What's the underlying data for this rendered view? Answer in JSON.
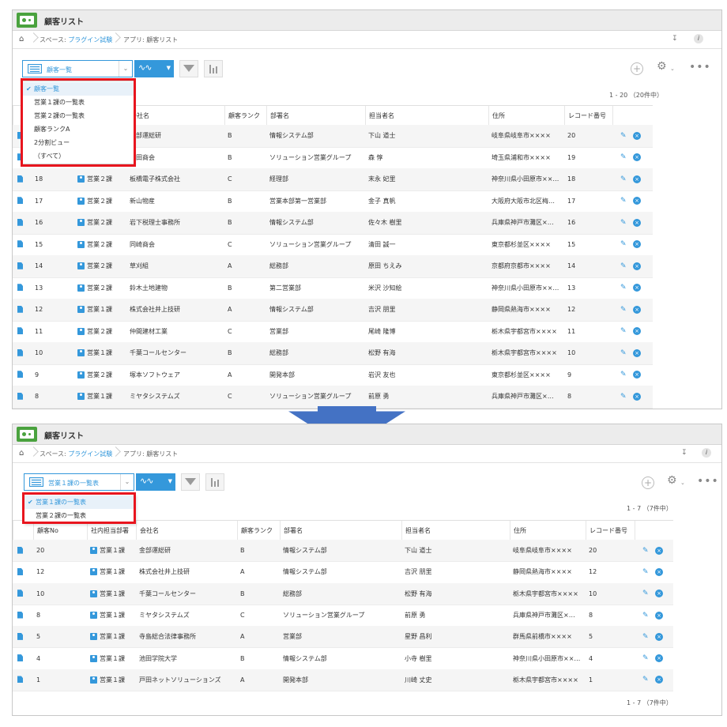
{
  "app_title": "顧客リスト",
  "breadcrumb": {
    "space_prefix": "スペース: ",
    "space_name": "プラグイン試験",
    "app": "アプリ: 顧客リスト"
  },
  "colors": {
    "accent": "#3498db",
    "highlight": "#e8151e",
    "arrow": "#4472c4",
    "app_icon": "#4aa23e"
  },
  "icons": {
    "home": "home-icon",
    "pin": "pin-icon",
    "info": "info-icon",
    "filter": "filter-icon",
    "chart": "bar-chart-icon",
    "add": "plus-icon",
    "settings": "gear-icon",
    "more": "more-icon",
    "record": "document-icon",
    "department": "org-icon",
    "edit": "pencil-icon",
    "delete": "close-icon"
  },
  "before": {
    "view_selected": "顧客一覧",
    "record_count": "1 - 20 （20件中）",
    "dropdown": [
      "顧客一覧",
      "営業１課の一覧表",
      "営業２課の一覧表",
      "顧客ランクA",
      "2分割ビュー",
      "（すべて）"
    ],
    "columns": [
      "",
      "",
      "",
      "会社名",
      "顧客ランク",
      "部署名",
      "担当者名",
      "住所",
      "レコード番号",
      ""
    ],
    "rows": [
      {
        "no": "",
        "dept": "",
        "company": "…部運総研",
        "rank": "B",
        "busho": "情報システム部",
        "tanto": "下山 道士",
        "addr": "岐阜県岐阜市××××",
        "rec": "20"
      },
      {
        "no": "",
        "dept": "",
        "company": "…田商会",
        "rank": "B",
        "busho": "ソリューション営業グループ",
        "tanto": "森 惇",
        "addr": "埼玉県浦和市××××",
        "rec": "19"
      },
      {
        "no": "18",
        "dept": "営業２課",
        "company": "板橋電子株式会社",
        "rank": "C",
        "busho": "経理部",
        "tanto": "末永 妃里",
        "addr": "神奈川県小田原市××…",
        "rec": "18"
      },
      {
        "no": "17",
        "dept": "営業２課",
        "company": "新山物産",
        "rank": "B",
        "busho": "営業本部第一営業部",
        "tanto": "金子 真帆",
        "addr": "大阪府大阪市北区梅…",
        "rec": "17"
      },
      {
        "no": "16",
        "dept": "営業２課",
        "company": "岩下税理士事務所",
        "rank": "B",
        "busho": "情報システム部",
        "tanto": "佐々木 樹里",
        "addr": "兵庫県神戸市灘区×…",
        "rec": "16"
      },
      {
        "no": "15",
        "dept": "営業２課",
        "company": "同崎商会",
        "rank": "C",
        "busho": "ソリューション営業グループ",
        "tanto": "清田 誠一",
        "addr": "東京都杉並区××××",
        "rec": "15"
      },
      {
        "no": "14",
        "dept": "営業２課",
        "company": "草刈組",
        "rank": "A",
        "busho": "総務部",
        "tanto": "原田 ちえみ",
        "addr": "京都府京都市××××",
        "rec": "14"
      },
      {
        "no": "13",
        "dept": "営業２課",
        "company": "鈴木土地建物",
        "rank": "B",
        "busho": "第二営業部",
        "tanto": "米沢 沙知絵",
        "addr": "神奈川県小田原市××…",
        "rec": "13"
      },
      {
        "no": "12",
        "dept": "営業１課",
        "company": "株式会社井上技研",
        "rank": "A",
        "busho": "情報システム部",
        "tanto": "吉沢 朋里",
        "addr": "静岡県熱海市××××",
        "rec": "12"
      },
      {
        "no": "11",
        "dept": "営業２課",
        "company": "仲間建材工業",
        "rank": "C",
        "busho": "営業部",
        "tanto": "尾崎 隆博",
        "addr": "栃木県宇都宮市××××",
        "rec": "11"
      },
      {
        "no": "10",
        "dept": "営業１課",
        "company": "千葉コールセンター",
        "rank": "B",
        "busho": "総務部",
        "tanto": "松野 有海",
        "addr": "栃木県宇都宮市××××",
        "rec": "10"
      },
      {
        "no": "9",
        "dept": "営業２課",
        "company": "塚本ソフトウェア",
        "rank": "A",
        "busho": "開発本部",
        "tanto": "岩沢 友也",
        "addr": "東京都杉並区××××",
        "rec": "9"
      },
      {
        "no": "8",
        "dept": "営業１課",
        "company": "ミヤタシステムズ",
        "rank": "C",
        "busho": "ソリューション営業グループ",
        "tanto": "前原 勇",
        "addr": "兵庫県神戸市灘区×…",
        "rec": "8"
      }
    ]
  },
  "after": {
    "view_selected": "営業１課の一覧表",
    "record_count": "1 - 7 （7件中）",
    "footer_count": "1 - 7 （7件中）",
    "dropdown": [
      "営業１課の一覧表",
      "営業２課の一覧表"
    ],
    "columns": [
      "",
      "顧客No",
      "社内担当部署",
      "会社名",
      "顧客ランク",
      "部署名",
      "担当者名",
      "住所",
      "レコード番号",
      ""
    ],
    "rows": [
      {
        "no": "20",
        "dept": "営業１課",
        "company": "金部運総研",
        "rank": "B",
        "busho": "情報システム部",
        "tanto": "下山 道士",
        "addr": "岐阜県岐阜市××××",
        "rec": "20"
      },
      {
        "no": "12",
        "dept": "営業１課",
        "company": "株式会社井上技研",
        "rank": "A",
        "busho": "情報システム部",
        "tanto": "吉沢 朋里",
        "addr": "静岡県熱海市××××",
        "rec": "12"
      },
      {
        "no": "10",
        "dept": "営業１課",
        "company": "千葉コールセンター",
        "rank": "B",
        "busho": "総務部",
        "tanto": "松野 有海",
        "addr": "栃木県宇都宮市××××",
        "rec": "10"
      },
      {
        "no": "8",
        "dept": "営業１課",
        "company": "ミヤタシステムズ",
        "rank": "C",
        "busho": "ソリューション営業グループ",
        "tanto": "前原 勇",
        "addr": "兵庫県神戸市灘区×…",
        "rec": "8"
      },
      {
        "no": "5",
        "dept": "営業１課",
        "company": "寺島総合法律事務所",
        "rank": "A",
        "busho": "営業部",
        "tanto": "星野 昌利",
        "addr": "群馬県前橋市××××",
        "rec": "5"
      },
      {
        "no": "4",
        "dept": "営業１課",
        "company": "池田学院大学",
        "rank": "B",
        "busho": "情報システム部",
        "tanto": "小寺 樹里",
        "addr": "神奈川県小田原市××…",
        "rec": "4"
      },
      {
        "no": "1",
        "dept": "営業１課",
        "company": "戸田ネットソリューションズ",
        "rank": "A",
        "busho": "開発本部",
        "tanto": "川崎 丈史",
        "addr": "栃木県宇都宮市××××",
        "rec": "1"
      }
    ]
  }
}
